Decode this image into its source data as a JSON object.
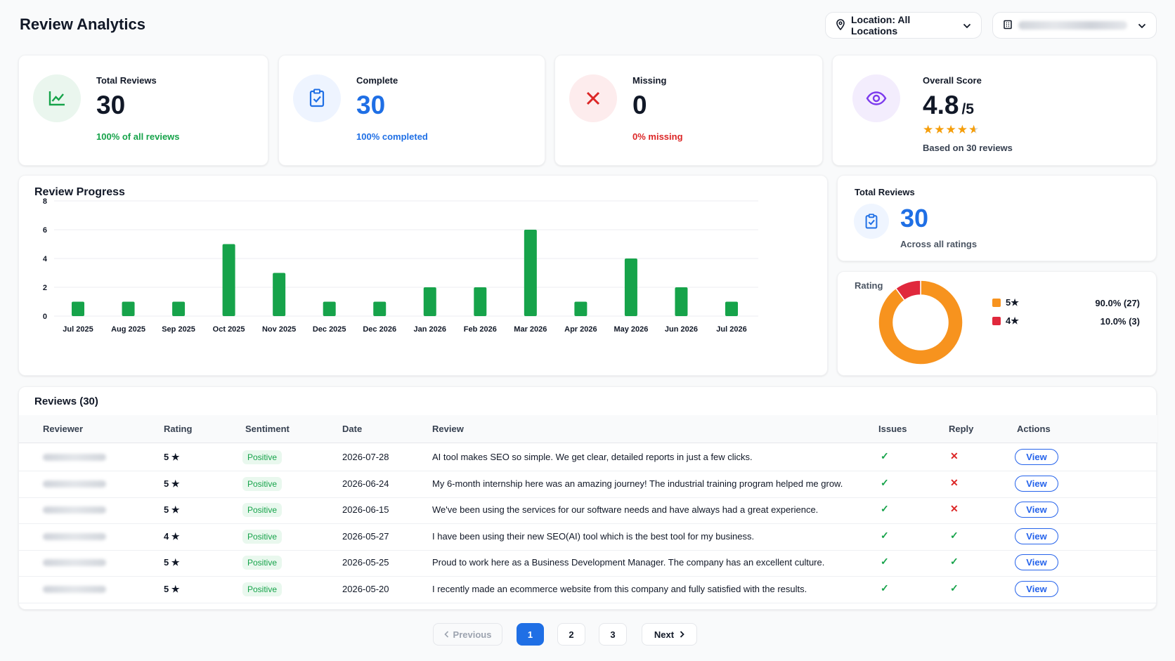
{
  "header": {
    "title": "Review Analytics",
    "location_label": "Location: All Locations",
    "company_label": "[redacted company]"
  },
  "kpis": {
    "total": {
      "label": "Total Reviews",
      "value": "30",
      "sub": "100% of all reviews",
      "color": "#16a34a",
      "icon": "trend-chart-icon"
    },
    "complete": {
      "label": "Complete",
      "value": "30",
      "sub": "100% completed",
      "color": "#1f6fe5",
      "icon": "clipboard-check-icon"
    },
    "missing": {
      "label": "Missing",
      "value": "0",
      "sub": "0% missing",
      "color": "#dc2626",
      "icon": "x-icon"
    },
    "overall": {
      "label": "Overall Score",
      "value": "4.8",
      "suffix": "/5",
      "stars": "★★★★",
      "half_star": "★",
      "rating": 4.8,
      "based_on": "Based on 30 reviews",
      "icon": "eye-icon"
    }
  },
  "progress": {
    "title": "Review Progress"
  },
  "chart_data": {
    "type": "bar",
    "title": "Review Progress",
    "categories": [
      "Jul 2025",
      "Aug 2025",
      "Sep 2025",
      "Oct 2025",
      "Nov 2025",
      "Dec 2025",
      "Dec 2026",
      "Jan 2026",
      "Feb 2026",
      "Mar 2026",
      "Apr 2026",
      "May 2026",
      "Jun 2026",
      "Jul 2026"
    ],
    "values": [
      1,
      1,
      1,
      5,
      3,
      1,
      1,
      2,
      2,
      6,
      1,
      4,
      2,
      1
    ],
    "ylim": [
      0,
      8
    ],
    "yticks": [
      0,
      2,
      4,
      6,
      8
    ],
    "grid": true,
    "color": "#16a34a"
  },
  "total_card": {
    "label": "Total Reviews",
    "value": "30",
    "sub": "Across all ratings"
  },
  "rating_chart": {
    "title": "Rating",
    "type": "pie",
    "slices": [
      {
        "label": "5★",
        "value": 27,
        "pct_text": "90.0% (27)",
        "color": "#f7931e"
      },
      {
        "label": "4★",
        "value": 3,
        "pct_text": "10.0% (3)",
        "color": "#e0283c"
      }
    ]
  },
  "reviews": {
    "title": "Reviews (30)",
    "columns": [
      "Reviewer",
      "Rating",
      "Sentiment",
      "Date",
      "Review",
      "Issues",
      "Reply",
      "Actions"
    ],
    "view_label": "View",
    "rows": [
      {
        "rating": "5 ★",
        "sentiment": "Positive",
        "date": "2026-07-28",
        "review": "AI tool makes SEO so simple. We get clear, detailed reports in just a few clicks.",
        "issues": "✓",
        "reply": "✕"
      },
      {
        "rating": "5 ★",
        "sentiment": "Positive",
        "date": "2026-06-24",
        "review": "My 6-month internship here was an amazing journey! The industrial training program helped me grow.",
        "issues": "✓",
        "reply": "✕"
      },
      {
        "rating": "5 ★",
        "sentiment": "Positive",
        "date": "2026-06-15",
        "review": "We've been using the services for our software needs and have always had a great experience.",
        "issues": "✓",
        "reply": "✕"
      },
      {
        "rating": "4 ★",
        "sentiment": "Positive",
        "date": "2026-05-27",
        "review": "I have been using their new SEO(AI) tool which is the best tool for my business.",
        "issues": "✓",
        "reply": "✓"
      },
      {
        "rating": "5 ★",
        "sentiment": "Positive",
        "date": "2026-05-25",
        "review": "Proud to work here as a Business Development Manager. The company has an excellent culture.",
        "issues": "✓",
        "reply": "✓"
      },
      {
        "rating": "5 ★",
        "sentiment": "Positive",
        "date": "2026-05-20",
        "review": "I recently made an ecommerce website from this company and fully satisfied with the results.",
        "issues": "✓",
        "reply": "✓"
      }
    ]
  },
  "pagination": {
    "previous": "Previous",
    "pages": [
      "1",
      "2",
      "3"
    ],
    "next": "Next",
    "current": "1"
  },
  "colors": {
    "green": "#16a34a",
    "blue": "#1f6fe5",
    "red": "#dc2626",
    "orange": "#f7931e",
    "purple": "#7c3aed"
  }
}
